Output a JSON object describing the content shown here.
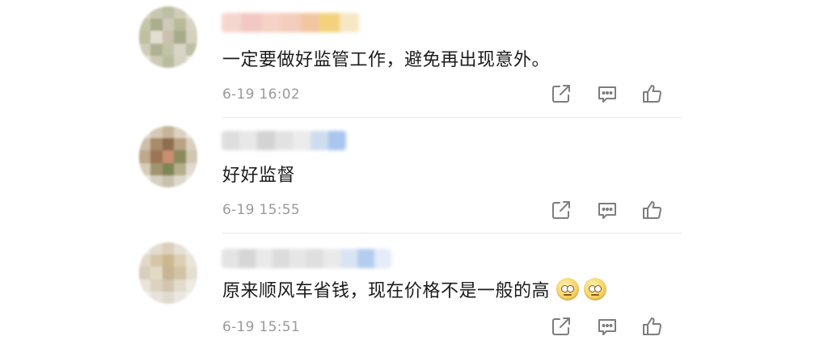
{
  "colors": {
    "text": "#1b1b1b",
    "meta": "#9a9a9a",
    "icon": "#7d7d7d",
    "divider": "#e9e9e9"
  },
  "actions": {
    "share_icon": "share-icon",
    "comment_icon": "comment-icon",
    "like_icon": "like-icon"
  },
  "comments": [
    {
      "text": "一定要做好监管工作，避免再出现意外。",
      "time": "6-19 16:02",
      "emojis": []
    },
    {
      "text": "好好监督",
      "time": "6-19 15:55",
      "emojis": []
    },
    {
      "text": "原来顺风车省钱，现在价格不是一般的高",
      "time": "6-19 15:51",
      "emojis": [
        "thinking-face-emoji",
        "thinking-face-emoji"
      ]
    }
  ]
}
